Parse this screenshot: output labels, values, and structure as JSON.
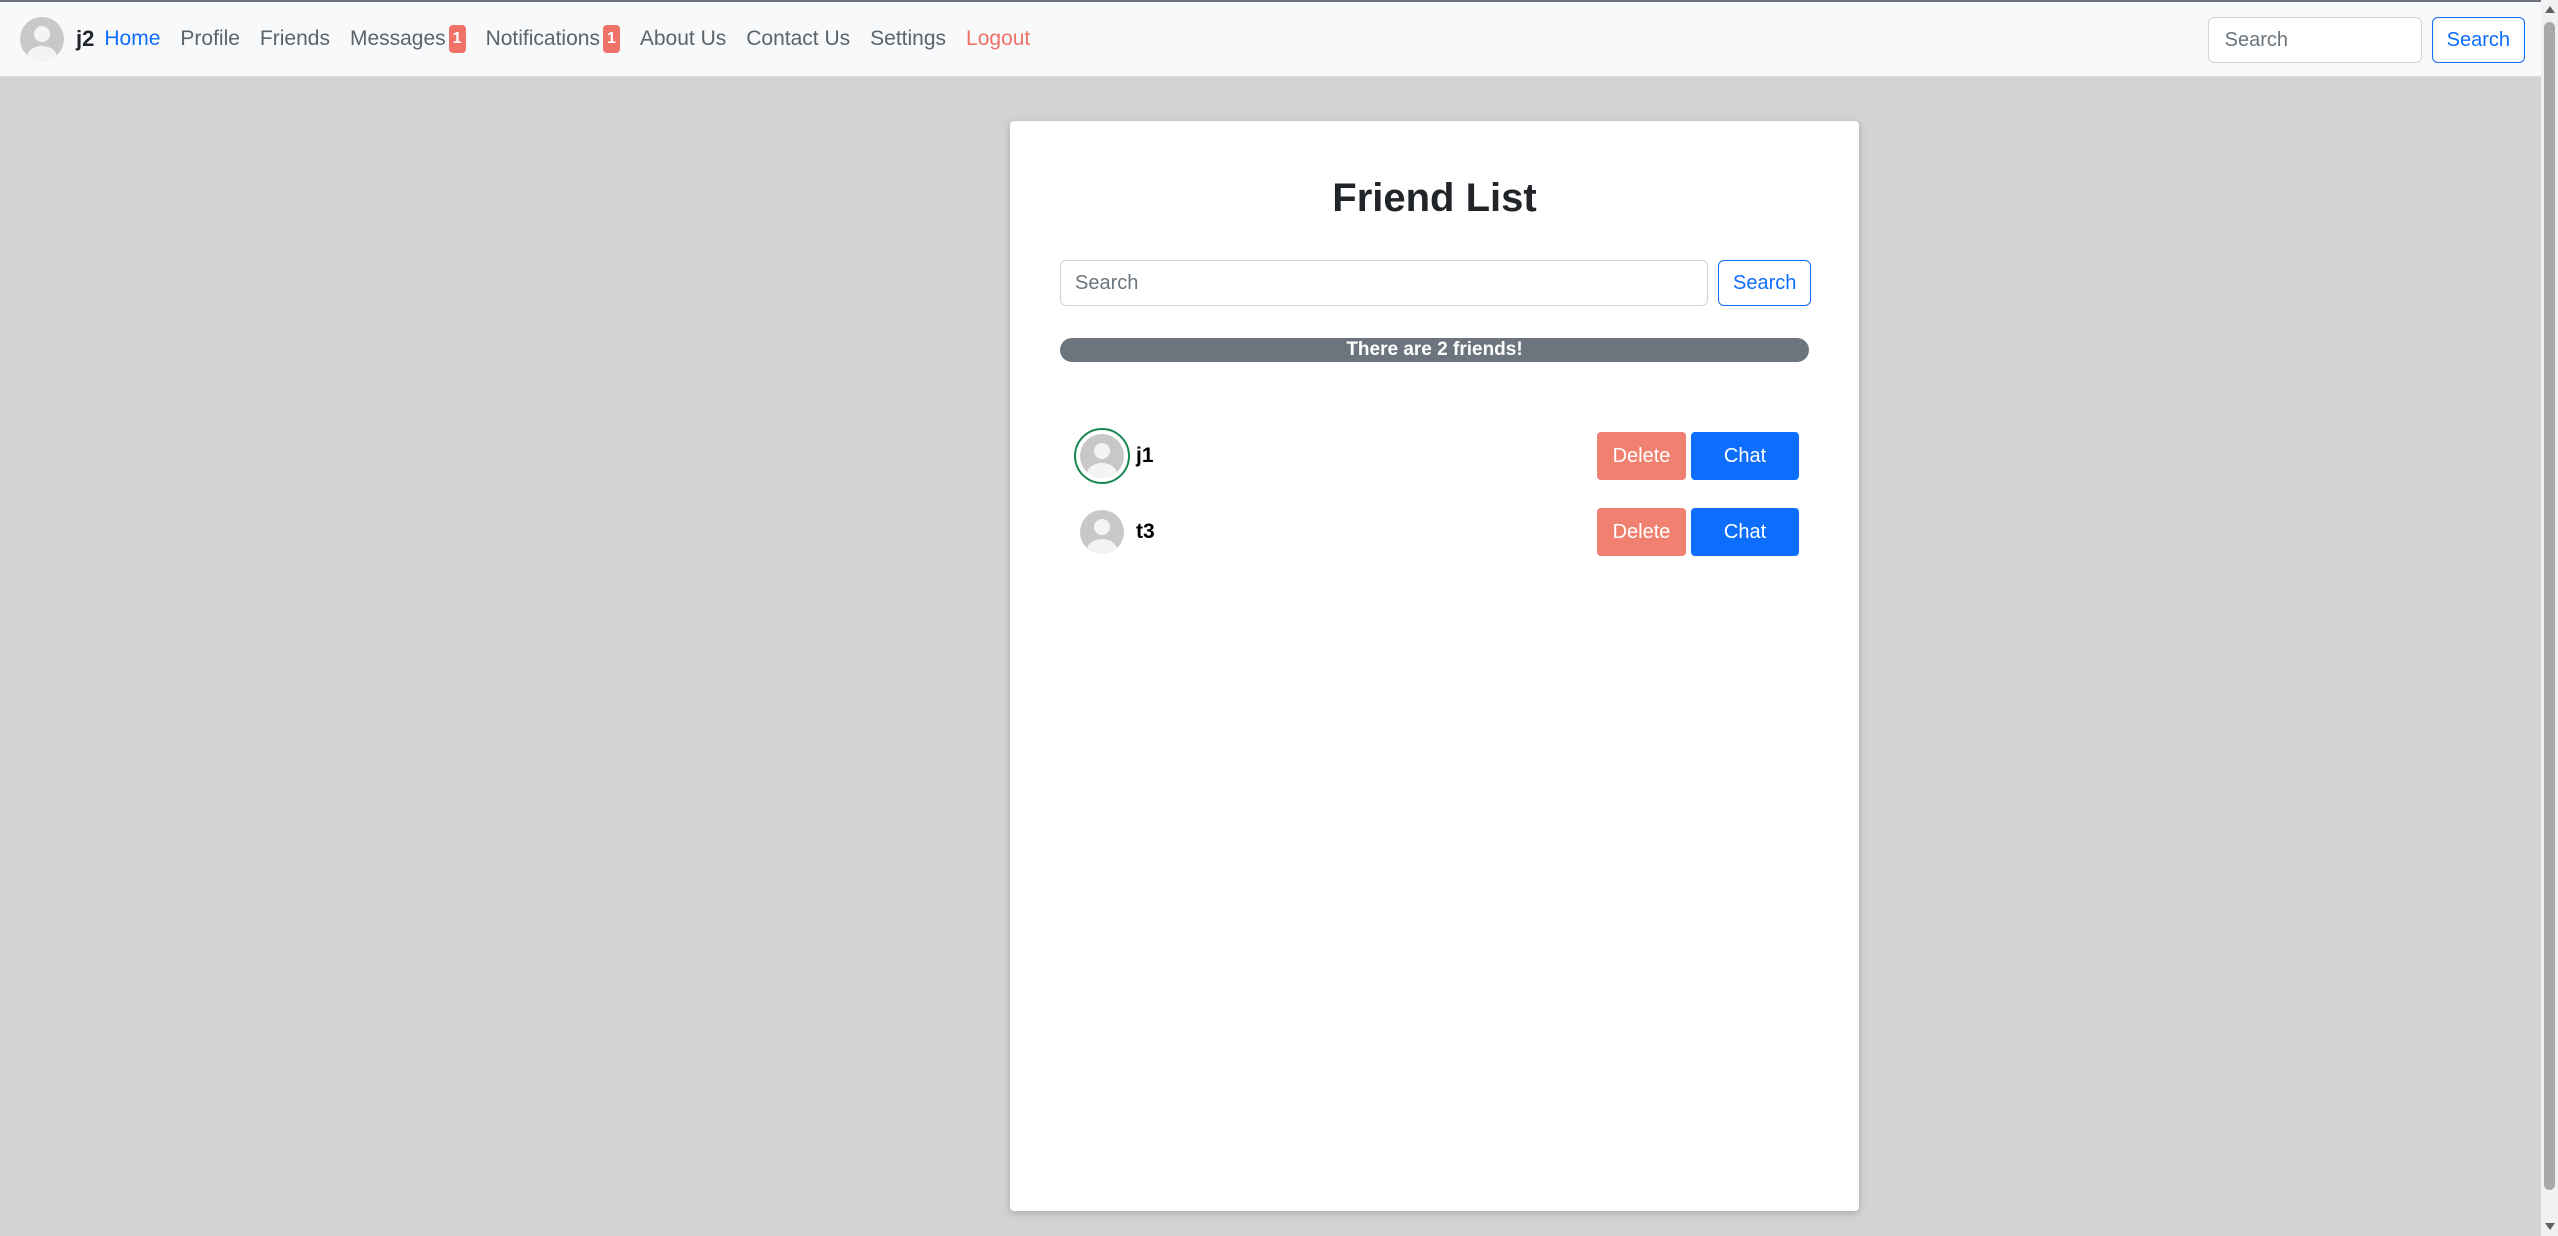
{
  "user": {
    "name": "j2",
    "avatar_icon": "default-avatar-icon"
  },
  "nav": {
    "home": "Home",
    "profile": "Profile",
    "friends": "Friends",
    "messages": "Messages",
    "messages_badge": "1",
    "notifications": "Notifications",
    "notifications_badge": "1",
    "about": "About Us",
    "contact": "Contact Us",
    "settings": "Settings",
    "logout": "Logout",
    "search_placeholder": "Search",
    "search_button": "Search"
  },
  "friend_list": {
    "title": "Friend List",
    "search_placeholder": "Search",
    "search_button": "Search",
    "count_text": "There are 2 friends!",
    "friends": [
      {
        "name": "j1",
        "online": true,
        "delete_label": "Delete",
        "chat_label": "Chat"
      },
      {
        "name": "t3",
        "online": false,
        "delete_label": "Delete",
        "chat_label": "Chat"
      }
    ]
  },
  "colors": {
    "primary": "#0d6efd",
    "danger_soft": "#f08070",
    "badge": "#f07167",
    "online_ring": "#198754",
    "background": "#d3d3d3",
    "count_bar": "#6c757d"
  }
}
